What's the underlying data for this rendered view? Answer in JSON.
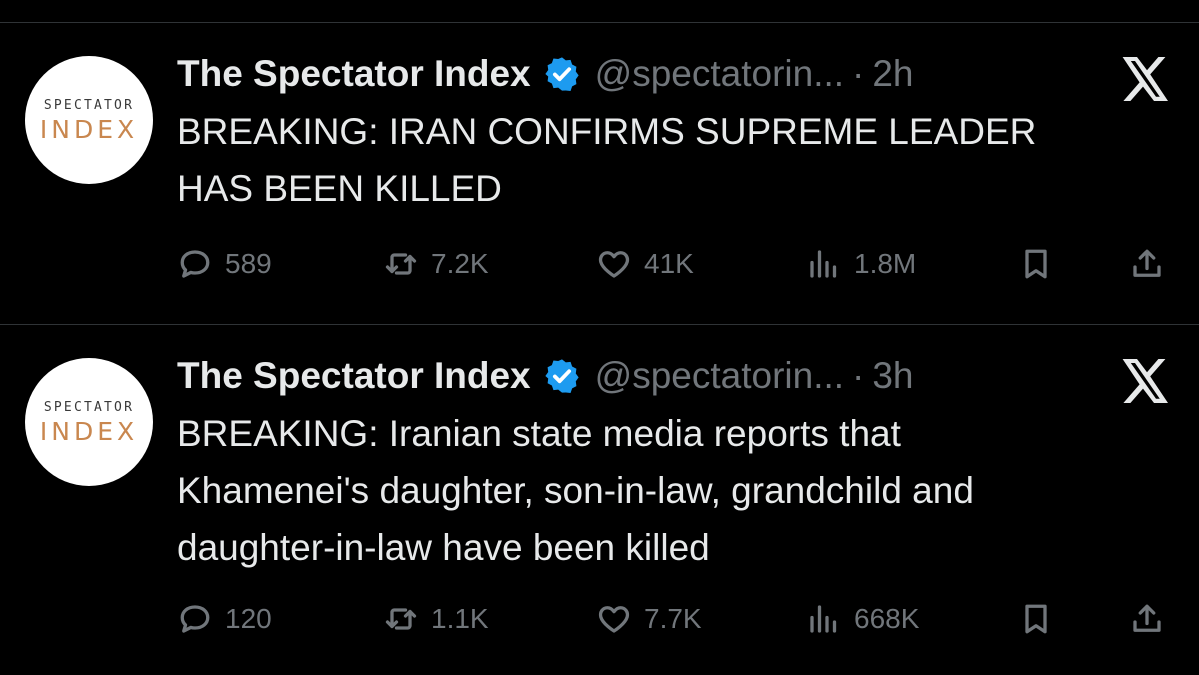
{
  "tweets": [
    {
      "avatar": {
        "line1": "SPECTATOR",
        "line2": "INDEX"
      },
      "name": "The Spectator Index",
      "handle": "@spectatorin...",
      "dot": "·",
      "time": "2h",
      "lines": [
        "BREAKING: IRAN CONFIRMS SUPREME LEADER",
        "HAS BEEN KILLED"
      ],
      "replies": "589",
      "reposts": "7.2K",
      "likes": "41K",
      "views": "1.8M"
    },
    {
      "avatar": {
        "line1": "SPECTATOR",
        "line2": "INDEX"
      },
      "name": "The Spectator Index",
      "handle": "@spectatorin...",
      "dot": "·",
      "time": "3h",
      "lines": [
        "BREAKING: Iranian state media reports that",
        "Khamenei's daughter, son-in-law, grandchild and",
        "daughter-in-law have been killed"
      ],
      "replies": "120",
      "reposts": "1.1K",
      "likes": "7.7K",
      "views": "668K"
    }
  ],
  "icons": {
    "verified": "verified-badge-icon",
    "platform": "x-logo-icon",
    "reply": "reply-icon",
    "repost": "repost-icon",
    "like": "heart-icon",
    "views": "views-icon",
    "bookmark": "bookmark-icon",
    "share": "share-icon"
  },
  "colors": {
    "background": "#000000",
    "text": "#e7e9ea",
    "muted": "#71767b",
    "verified": "#1d9bf0",
    "divider": "#2f3336",
    "brand_orange": "#c9874f"
  }
}
